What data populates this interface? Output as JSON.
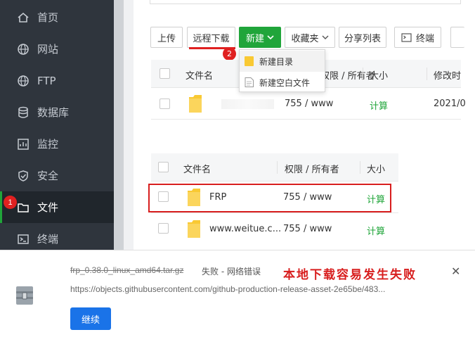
{
  "sidebar": {
    "items": [
      {
        "label": "首页",
        "icon": "home-icon"
      },
      {
        "label": "网站",
        "icon": "globe-icon"
      },
      {
        "label": "FTP",
        "icon": "globe-icon"
      },
      {
        "label": "数据库",
        "icon": "database-icon"
      },
      {
        "label": "监控",
        "icon": "monitor-icon"
      },
      {
        "label": "安全",
        "icon": "shield-icon"
      },
      {
        "label": "文件",
        "icon": "folder-icon"
      },
      {
        "label": "终端",
        "icon": "terminal-icon"
      }
    ],
    "active_index": 6,
    "step_badge": "1"
  },
  "toolbar": {
    "upload": "上传",
    "remote_download": "远程下载",
    "new": "新建",
    "favorites": "收藏夹",
    "share_list": "分享列表",
    "terminal": "终端",
    "step_badge": "2"
  },
  "new_menu": {
    "items": [
      "新建目录",
      "新建空白文件"
    ]
  },
  "table1": {
    "headers": [
      "文件名",
      "权限 / 所有者",
      "大小",
      "修改时"
    ],
    "rows": [
      {
        "permission": "755 / www",
        "size": "计算",
        "modified": "2021/0"
      }
    ]
  },
  "table2": {
    "headers": [
      "文件名",
      "权限 / 所有者",
      "大小"
    ],
    "rows": [
      {
        "name": "FRP",
        "permission": "755 / www",
        "size": "计算"
      },
      {
        "name": "www.weitue.c...",
        "permission": "755 / www",
        "size": "计算"
      }
    ]
  },
  "download": {
    "filename": "frp_0.38.0_linux_amd64.tar.gz",
    "status": "失败 - 网络错误",
    "url": "https://objects.githubusercontent.com/github-production-release-asset-2e65be/483...",
    "note": "本地下载容易发生失败",
    "continue": "继续",
    "close": "✕"
  },
  "colors": {
    "sidebar_bg": "#2f353d",
    "accent_green": "#20a53a",
    "alert_red": "#d81e1e",
    "continue_blue": "#1a73e8"
  }
}
